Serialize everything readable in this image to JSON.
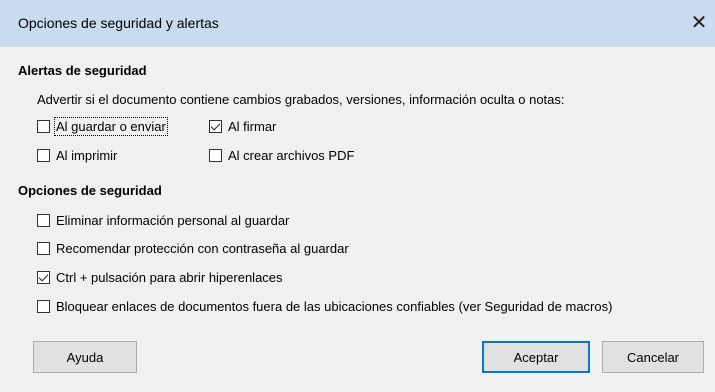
{
  "dialog": {
    "title": "Opciones de seguridad y alertas",
    "close_icon": "close-icon"
  },
  "alerts": {
    "heading": "Alertas de seguridad",
    "description": "Advertir si el documento contiene cambios grabados, versiones, información oculta o notas:",
    "options": [
      {
        "label": "Al guardar o enviar",
        "checked": false
      },
      {
        "label": "Al firmar",
        "checked": true
      },
      {
        "label": "Al imprimir",
        "checked": false
      },
      {
        "label": "Al crear archivos PDF",
        "checked": false
      }
    ]
  },
  "security": {
    "heading": "Opciones de seguridad",
    "options": [
      {
        "label": "Eliminar información personal al guardar",
        "checked": false
      },
      {
        "label": "Recomendar protección con contraseña al guardar",
        "checked": false
      },
      {
        "label": "Ctrl + pulsación para abrir hiperenlaces",
        "checked": true
      },
      {
        "label": "Bloquear enlaces de documentos fuera de las ubicaciones confiables (ver Seguridad de macros)",
        "checked": false
      }
    ]
  },
  "buttons": {
    "help": "Ayuda",
    "ok": "Aceptar",
    "cancel": "Cancelar"
  },
  "colors": {
    "titlebar": "#c9dbef",
    "body": "#f0f0f0",
    "default_button_border": "#0078d7"
  }
}
